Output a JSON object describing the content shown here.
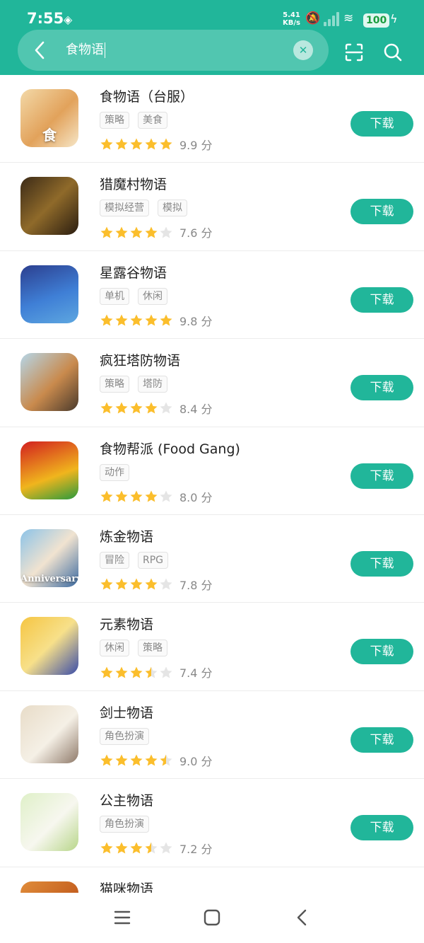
{
  "status_bar": {
    "time": "7:55",
    "net_speed_value": "5.41",
    "net_speed_unit": "KB/s",
    "battery": "100"
  },
  "search": {
    "query": "食物语"
  },
  "download_label": "下载",
  "colors": {
    "brand": "#21b69a",
    "star": "#fbbe2c",
    "star_empty": "#e5e5e5"
  },
  "apps": [
    {
      "name": "食物语（台服）",
      "tags": [
        "策略",
        "美食"
      ],
      "rating": 5,
      "score": "9.9 分",
      "icon_text": "食"
    },
    {
      "name": "猎魔村物语",
      "tags": [
        "模拟经营",
        "模拟"
      ],
      "rating": 4,
      "score": "7.6 分",
      "icon_text": ""
    },
    {
      "name": "星露谷物语",
      "tags": [
        "单机",
        "休闲"
      ],
      "rating": 5,
      "score": "9.8 分",
      "icon_text": ""
    },
    {
      "name": "疯狂塔防物语",
      "tags": [
        "策略",
        "塔防"
      ],
      "rating": 4,
      "score": "8.4 分",
      "icon_text": ""
    },
    {
      "name": "食物帮派 (Food Gang)",
      "tags": [
        "动作"
      ],
      "rating": 4,
      "score": "8.0 分",
      "icon_text": ""
    },
    {
      "name": "炼金物语",
      "tags": [
        "冒险",
        "RPG"
      ],
      "rating": 4,
      "score": "7.8 分",
      "icon_text": "Anniversary"
    },
    {
      "name": "元素物语",
      "tags": [
        "休闲",
        "策略"
      ],
      "rating": 3.5,
      "score": "7.4 分",
      "icon_text": ""
    },
    {
      "name": "剑士物语",
      "tags": [
        "角色扮演"
      ],
      "rating": 4.5,
      "score": "9.0 分",
      "icon_text": ""
    },
    {
      "name": "公主物语",
      "tags": [
        "角色扮演"
      ],
      "rating": 3.5,
      "score": "7.2 分",
      "icon_text": ""
    },
    {
      "name": "猫咪物语",
      "tags": [],
      "rating": 0,
      "score": "",
      "icon_text": ""
    }
  ]
}
